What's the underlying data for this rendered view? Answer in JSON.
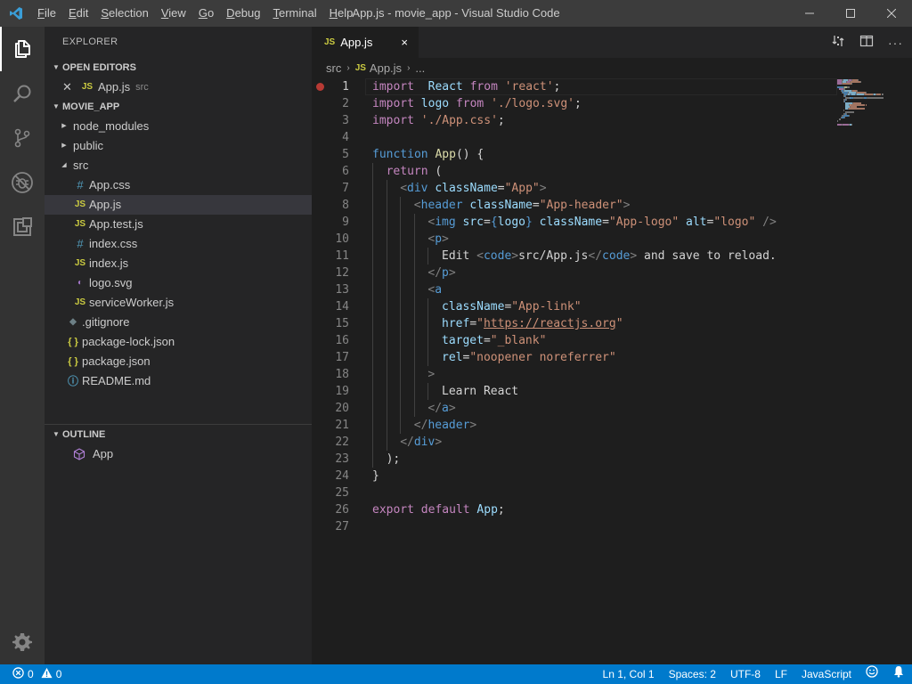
{
  "window": {
    "title": "App.js - movie_app - Visual Studio Code"
  },
  "menu": [
    "File",
    "Edit",
    "Selection",
    "View",
    "Go",
    "Debug",
    "Terminal",
    "Help"
  ],
  "menu_mnemonics": [
    "F",
    "E",
    "S",
    "V",
    "G",
    "D",
    "T",
    "H"
  ],
  "sidebar": {
    "title": "EXPLORER",
    "open_editors": {
      "label": "OPEN EDITORS",
      "items": [
        {
          "badge": "JS",
          "name": "App.js",
          "desc": "src"
        }
      ]
    },
    "project": {
      "label": "MOVIE_APP",
      "items": [
        {
          "name": "node_modules",
          "type": "folder",
          "depth": 0,
          "expanded": false
        },
        {
          "name": "public",
          "type": "folder",
          "depth": 0,
          "expanded": false
        },
        {
          "name": "src",
          "type": "folder",
          "depth": 0,
          "expanded": true
        },
        {
          "name": "App.css",
          "type": "css",
          "depth": 1
        },
        {
          "name": "App.js",
          "type": "js",
          "depth": 1,
          "selected": true
        },
        {
          "name": "App.test.js",
          "type": "js",
          "depth": 1
        },
        {
          "name": "index.css",
          "type": "css",
          "depth": 1
        },
        {
          "name": "index.js",
          "type": "js",
          "depth": 1
        },
        {
          "name": "logo.svg",
          "type": "svg",
          "depth": 1
        },
        {
          "name": "serviceWorker.js",
          "type": "js",
          "depth": 1
        },
        {
          "name": ".gitignore",
          "type": "git",
          "depth": 0
        },
        {
          "name": "package-lock.json",
          "type": "json",
          "depth": 0
        },
        {
          "name": "package.json",
          "type": "json",
          "depth": 0
        },
        {
          "name": "README.md",
          "type": "info",
          "depth": 0
        }
      ]
    },
    "outline": {
      "label": "OUTLINE",
      "items": [
        {
          "name": "App"
        }
      ]
    }
  },
  "editor": {
    "tab": {
      "badge": "JS",
      "label": "App.js",
      "close": "×"
    },
    "breadcrumbs": [
      "src",
      "App.js",
      "..."
    ],
    "lines": [
      [
        [
          "k",
          "import"
        ],
        [
          "",
          "  "
        ],
        [
          "v",
          "React"
        ],
        [
          "",
          " "
        ],
        [
          "k",
          "from"
        ],
        [
          "",
          " "
        ],
        [
          "s",
          "'react'"
        ],
        [
          "",
          ";"
        ]
      ],
      [
        [
          "k",
          "import"
        ],
        [
          "",
          " "
        ],
        [
          "v",
          "logo"
        ],
        [
          "",
          " "
        ],
        [
          "k",
          "from"
        ],
        [
          "",
          " "
        ],
        [
          "s",
          "'./logo.svg'"
        ],
        [
          "",
          ";"
        ]
      ],
      [
        [
          "k",
          "import"
        ],
        [
          "",
          " "
        ],
        [
          "s",
          "'./App.css'"
        ],
        [
          "",
          ";"
        ]
      ],
      [],
      [
        [
          "kb",
          "function"
        ],
        [
          "",
          " "
        ],
        [
          "fn",
          "App"
        ],
        [
          "",
          "() {"
        ]
      ],
      [
        [
          "",
          ""
        ],
        [
          "k",
          "return"
        ],
        [
          "",
          " ("
        ]
      ],
      [
        [
          "g",
          "<"
        ],
        [
          "t",
          "div"
        ],
        [
          "",
          " "
        ],
        [
          "a",
          "className"
        ],
        [
          "",
          "="
        ],
        [
          "s",
          "\"App\""
        ],
        [
          "g",
          ">"
        ]
      ],
      [
        [
          "g",
          "<"
        ],
        [
          "t",
          "header"
        ],
        [
          "",
          " "
        ],
        [
          "a",
          "className"
        ],
        [
          "",
          "="
        ],
        [
          "s",
          "\"App-header\""
        ],
        [
          "g",
          ">"
        ]
      ],
      [
        [
          "g",
          "<"
        ],
        [
          "t",
          "img"
        ],
        [
          "",
          " "
        ],
        [
          "a",
          "src"
        ],
        [
          "",
          "="
        ],
        [
          "kb",
          "{"
        ],
        [
          "v",
          "logo"
        ],
        [
          "kb",
          "}"
        ],
        [
          "",
          " "
        ],
        [
          "a",
          "className"
        ],
        [
          "",
          "="
        ],
        [
          "s",
          "\"App-logo\""
        ],
        [
          "",
          " "
        ],
        [
          "a",
          "alt"
        ],
        [
          "",
          "="
        ],
        [
          "s",
          "\"logo\""
        ],
        [
          "",
          " "
        ],
        [
          "g",
          "/>"
        ]
      ],
      [
        [
          "g",
          "<"
        ],
        [
          "t",
          "p"
        ],
        [
          "g",
          ">"
        ]
      ],
      [
        [
          "",
          "Edit "
        ],
        [
          "g",
          "<"
        ],
        [
          "t",
          "code"
        ],
        [
          "g",
          ">"
        ],
        [
          "",
          "src/App.js"
        ],
        [
          "g",
          "</"
        ],
        [
          "t",
          "code"
        ],
        [
          "g",
          ">"
        ],
        [
          "",
          " and save to reload."
        ]
      ],
      [
        [
          "g",
          "</"
        ],
        [
          "t",
          "p"
        ],
        [
          "g",
          ">"
        ]
      ],
      [
        [
          "g",
          "<"
        ],
        [
          "t",
          "a"
        ]
      ],
      [
        [
          "a",
          "className"
        ],
        [
          "",
          "="
        ],
        [
          "s",
          "\"App-link\""
        ]
      ],
      [
        [
          "a",
          "href"
        ],
        [
          "",
          "="
        ],
        [
          "s",
          "\""
        ],
        [
          "link",
          "https://reactjs.org"
        ],
        [
          "s",
          "\""
        ]
      ],
      [
        [
          "a",
          "target"
        ],
        [
          "",
          "="
        ],
        [
          "s",
          "\"_blank\""
        ]
      ],
      [
        [
          "a",
          "rel"
        ],
        [
          "",
          "="
        ],
        [
          "s",
          "\"noopener noreferrer\""
        ]
      ],
      [
        [
          "g",
          ">"
        ]
      ],
      [
        [
          "",
          "Learn React"
        ]
      ],
      [
        [
          "g",
          "</"
        ],
        [
          "t",
          "a"
        ],
        [
          "g",
          ">"
        ]
      ],
      [
        [
          "g",
          "</"
        ],
        [
          "t",
          "header"
        ],
        [
          "g",
          ">"
        ]
      ],
      [
        [
          "g",
          "</"
        ],
        [
          "t",
          "div"
        ],
        [
          "g",
          ">"
        ]
      ],
      [
        [
          "",
          ");"
        ]
      ],
      [
        [
          "",
          "}"
        ]
      ],
      [],
      [
        [
          "k",
          "export"
        ],
        [
          "",
          " "
        ],
        [
          "k",
          "default"
        ],
        [
          "",
          " "
        ],
        [
          "v",
          "App"
        ],
        [
          "",
          ";"
        ]
      ],
      []
    ],
    "indents": [
      0,
      0,
      0,
      0,
      0,
      2,
      4,
      6,
      8,
      8,
      10,
      8,
      8,
      10,
      10,
      10,
      10,
      8,
      10,
      8,
      6,
      4,
      2,
      0,
      0,
      0,
      0
    ]
  },
  "status": {
    "errors": "0",
    "warnings": "0",
    "position": "Ln 1, Col 1",
    "spaces": "Spaces: 2",
    "encoding": "UTF-8",
    "eol": "LF",
    "language": "JavaScript"
  }
}
